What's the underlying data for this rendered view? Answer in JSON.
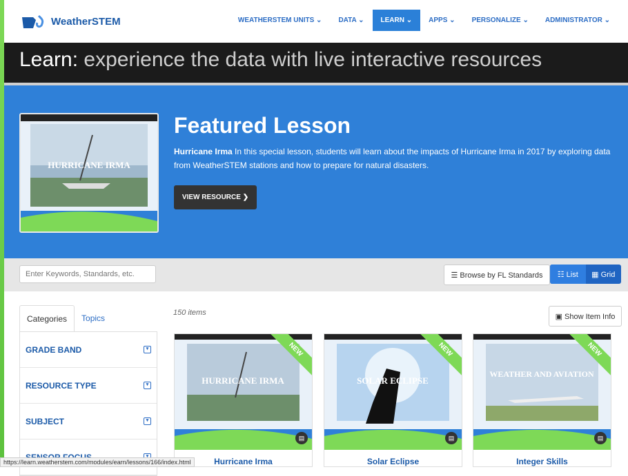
{
  "brand": {
    "name": "WeatherSTEM"
  },
  "nav": [
    {
      "label": "WEATHERSTEM UNITS",
      "caret": "⌄"
    },
    {
      "label": "DATA",
      "caret": "⌄"
    },
    {
      "label": "LEARN",
      "caret": "⌄"
    },
    {
      "label": "APPS",
      "caret": "⌄"
    },
    {
      "label": "PERSONALIZE",
      "caret": "⌄"
    },
    {
      "label": "ADMINISTRATOR",
      "caret": "⌄"
    }
  ],
  "hero": {
    "prefix": "Learn:",
    "text": "experience the data with live interactive resources"
  },
  "featured": {
    "heading": "Featured Lesson",
    "lesson_name": "Hurricane Irma",
    "description": "In this special lesson, students will learn about the impacts of Hurricane Irma in 2017 by exploring data from WeatherSTEM stations and how to prepare for natural disasters.",
    "button": "VIEW RESOURCE ❯",
    "thumb_text": "HURRICANE IRMA"
  },
  "toolbar": {
    "search_placeholder": "Enter Keywords, Standards, etc.",
    "browse": "☰ Browse by FL Standards",
    "list": "☷ List",
    "grid": "▦ Grid"
  },
  "sidebar": {
    "tabs": [
      "Categories",
      "Topics"
    ],
    "categories": [
      "GRADE BAND",
      "RESOURCE TYPE",
      "SUBJECT",
      "SENSOR FOCUS"
    ]
  },
  "results": {
    "count": "150 items",
    "show_info": "▣ Show Item Info",
    "cards": [
      {
        "title": "Hurricane Irma",
        "thumb": "HURRICANE IRMA",
        "badge": "NEW"
      },
      {
        "title": "Solar Eclipse",
        "thumb": "SOLAR ECLIPSE",
        "badge": "NEW"
      },
      {
        "title": "Integer Skills",
        "thumb": "WEATHER AND AVIATION",
        "badge": "NEW"
      }
    ]
  },
  "status_url": "https://learn.weatherstem.com/modules/earn/lessons/166/index.html"
}
